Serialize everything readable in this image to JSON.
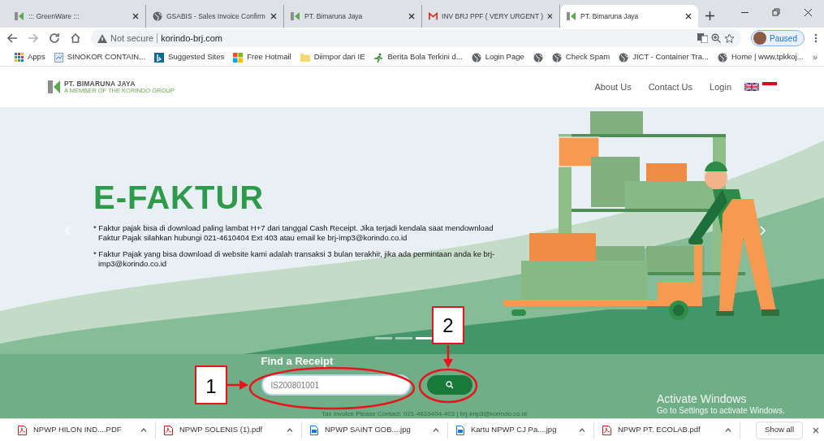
{
  "browser": {
    "tabs": [
      {
        "title": "::: GreenWare :::",
        "selected": false
      },
      {
        "title": "GSABIS - Sales Invoice Confirm",
        "selected": false
      },
      {
        "title": "PT. Bimaruna Jaya",
        "selected": false
      },
      {
        "title": "INV BRJ PPF ( VERY URGENT )",
        "selected": false
      },
      {
        "title": "PT. Bimaruna Jaya",
        "selected": true
      }
    ],
    "security": "Not secure",
    "url": "korindo-brj.com",
    "profile": "Paused",
    "bookmarks": [
      {
        "kind": "labeled",
        "label": "Apps"
      },
      {
        "kind": "labeled",
        "label": "SINOKOR CONTAIN..."
      },
      {
        "kind": "labeled",
        "label": "Suggested Sites"
      },
      {
        "kind": "labeled",
        "label": "Free Hotmail"
      },
      {
        "kind": "labeled",
        "label": "Diimpor dari IE"
      },
      {
        "kind": "labeled",
        "label": "Berita Bola Terkini d..."
      },
      {
        "kind": "labeled",
        "label": "Login Page"
      },
      {
        "kind": "icon_only"
      },
      {
        "kind": "labeled",
        "label": "Check Spam"
      },
      {
        "kind": "labeled",
        "label": "JICT - Container Tra..."
      },
      {
        "kind": "labeled",
        "label": "Home | www.tpkkoj..."
      }
    ],
    "more_bookmarks": "»"
  },
  "site": {
    "logo": {
      "name": "PT. BIMARUNA JAYA",
      "tagline": "A MEMBER OF THE KORINDO GROUP"
    },
    "nav": [
      "About Us",
      "Contact Us",
      "Login"
    ],
    "hero": {
      "title": "E-FAKTUR",
      "notes": [
        "* Faktur pajak bisa di download paling lambat H+7 dari tanggal Cash Receipt. Jika terjadi kendala saat mendownload Faktur Pajak silahkan hubungi 021-4610404 Ext 403 atau email ke brj-imp3@korindo.co.id",
        "* Faktur Pajak yang bisa download di website kami adalah transaksi 3 bulan terakhir, jika ada permintaan anda ke brj-imp3@korindo.co.id"
      ],
      "slides": [
        {
          "selected": false
        },
        {
          "selected": false
        },
        {
          "selected": true
        }
      ]
    },
    "search": {
      "heading": "Find a Receipt",
      "value": "IS200801001",
      "footer": "Tax Invoice Please Contact: 021-4610404-403 | brj-imp3@korindo.co.id"
    }
  },
  "annotations": [
    {
      "label": "1"
    },
    {
      "label": "2"
    }
  ],
  "os_notice": {
    "title": "Activate Windows",
    "subtitle": "Go to Settings to activate Windows."
  },
  "downloads": {
    "items": [
      {
        "name": "NPWP HILON IND....PDF",
        "kind": "pdf"
      },
      {
        "name": "NPWP SOLENIS (1).pdf",
        "kind": "pdf"
      },
      {
        "name": "NPWP SAINT GOB....jpg",
        "kind": "image"
      },
      {
        "name": "Kartu NPWP CJ Pa....jpg",
        "kind": "image"
      },
      {
        "name": "NPWP PT. ECOLAB.pdf",
        "kind": "pdf"
      }
    ],
    "show_all": "Show all"
  }
}
